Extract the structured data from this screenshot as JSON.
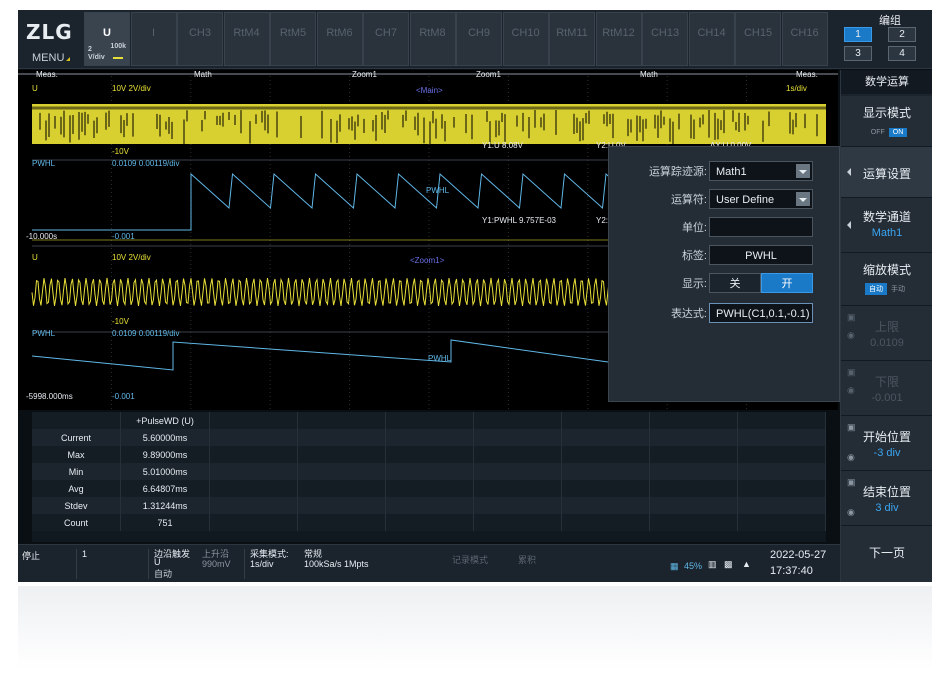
{
  "brand": {
    "logo": "ZLG",
    "menu": "MENU"
  },
  "channel_tabs": [
    {
      "label": "U",
      "active": true,
      "scale": "2\nV/div",
      "bw": "100k"
    },
    {
      "label": "I",
      "active": false
    },
    {
      "label": "CH3",
      "active": false
    },
    {
      "label": "RtM4",
      "active": false
    },
    {
      "label": "RtM5",
      "active": false
    },
    {
      "label": "RtM6",
      "active": false
    },
    {
      "label": "CH7",
      "active": false
    },
    {
      "label": "RtM8",
      "active": false
    },
    {
      "label": "CH9",
      "active": false
    },
    {
      "label": "CH10",
      "active": false
    },
    {
      "label": "RtM11",
      "active": false
    },
    {
      "label": "RtM12",
      "active": false
    },
    {
      "label": "CH13",
      "active": false
    },
    {
      "label": "CH14",
      "active": false
    },
    {
      "label": "CH15",
      "active": false
    },
    {
      "label": "CH16",
      "active": false
    }
  ],
  "group": {
    "title": "编组",
    "buttons": [
      "1",
      "2",
      "3",
      "4"
    ],
    "selected": "1"
  },
  "scope": {
    "zone_labels": [
      "Meas.",
      "Math",
      "Zoom1",
      "Zoom1",
      "Math",
      "Meas."
    ],
    "w1": {
      "name": "U",
      "scale": "10V   2V/div",
      "low": "-10V",
      "tag": "<Main>",
      "time": "1s/div",
      "cursor": "Y1:U 8.08V",
      "cursor2": "Y2:U 0V"
    },
    "w2": {
      "name": "PWHL",
      "scale": "0.0109   0.00119/div",
      "low": "-0.001",
      "tag": "PWHL",
      "start": "-10.000s",
      "cursor": "Y1:PWHL 9.757E-03",
      "cursor2": "Y2:",
      "cursor3": "ΔY:U 0.00V"
    },
    "w3": {
      "name": "U",
      "scale": "10V   2V/div",
      "low": "-10V",
      "tag": "<Zoom1>"
    },
    "w4": {
      "name": "PWHL",
      "scale": "0.0109   0.00119/div",
      "low": "-0.001",
      "tag": "PWHL",
      "start": "-5998.000ms"
    }
  },
  "meas_table": {
    "header": "+PulseWD (U)",
    "rows": [
      {
        "label": "Current",
        "value": "5.60000ms"
      },
      {
        "label": "Max",
        "value": "9.89000ms"
      },
      {
        "label": "Min",
        "value": "5.01000ms"
      },
      {
        "label": "Avg",
        "value": "6.64807ms"
      },
      {
        "label": "Stdev",
        "value": "1.31244ms"
      },
      {
        "label": "Count",
        "value": "751"
      }
    ]
  },
  "status": {
    "run": "停止",
    "count": "1",
    "trig_type": "边沿触发",
    "trig_src": "U",
    "trig_mode": "自动",
    "trig_edge": "上升沿",
    "trig_level": "990mV",
    "acq_label": "采集模式:",
    "acq_div": "1s/div",
    "acq_mode": "常规",
    "acq_rate": "100kSa/s   1Mpts",
    "rec_mode": "记录模式",
    "archive": "累积",
    "storage": "45%",
    "date": "2022-05-27",
    "time": "17:37:40"
  },
  "sidebar": {
    "title": "数学运算",
    "display_mode": {
      "label": "显示模式",
      "off": "OFF",
      "on": "ON"
    },
    "calc_settings": "运算设置",
    "math_channel": {
      "label": "数学通道",
      "value": "Math1"
    },
    "zoom_mode": {
      "label": "缩放模式",
      "auto": "自动",
      "manual": "手动"
    },
    "upper": {
      "label": "上限",
      "value": "0.0109"
    },
    "lower": {
      "label": "下限",
      "value": "-0.001"
    },
    "start_pos": {
      "label": "开始位置",
      "value": "-3 div"
    },
    "end_pos": {
      "label": "结束位置",
      "value": "3 div"
    },
    "next": "下一页"
  },
  "math_panel": {
    "source_label": "运算踪迹源:",
    "source_value": "Math1",
    "op_label": "运算符:",
    "op_value": "User Define",
    "unit_label": "单位:",
    "unit_value": "",
    "tag_label": "标签:",
    "tag_value": "PWHL",
    "display_label": "显示:",
    "display_off": "关",
    "display_on": "开",
    "expr_label": "表达式:",
    "expr_value": "PWHL(C1,0.1,-0.1)"
  },
  "colors": {
    "ch1": "#e8e038",
    "math": "#60b8e8",
    "accent": "#1a7ac8",
    "background": "#0a0f14"
  }
}
